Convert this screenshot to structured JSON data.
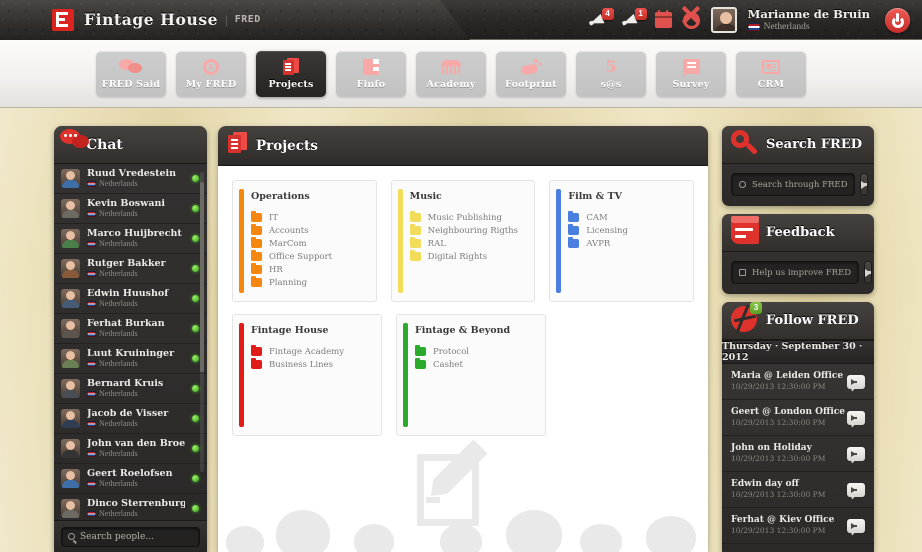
{
  "header": {
    "brand": "Fintage House",
    "brand_divider": "|",
    "brand_sub": "FRED",
    "notif1_badge": "4",
    "notif2_badge": "1",
    "user_name": "Marianne de Bruin",
    "user_country": "Netherlands"
  },
  "nav": {
    "tabs": [
      {
        "label": "FRED Said",
        "icon": "speech-icon",
        "active": false
      },
      {
        "label": "My FRED",
        "icon": "clock-icon",
        "active": false
      },
      {
        "label": "Projects",
        "icon": "documents-icon",
        "active": true
      },
      {
        "label": "Finfo",
        "icon": "f-letter-icon",
        "active": false
      },
      {
        "label": "Academy",
        "icon": "academy-icon",
        "active": false
      },
      {
        "label": "Footprint",
        "icon": "footprint-icon",
        "active": false
      },
      {
        "label": "s@s",
        "icon": "five-icon",
        "active": false
      },
      {
        "label": "Survey",
        "icon": "survey-icon",
        "active": false
      },
      {
        "label": "CRM",
        "icon": "crm-icon",
        "active": false
      }
    ]
  },
  "chat": {
    "title": "Chat",
    "search_placeholder": "Search people...",
    "people": [
      {
        "name": "Ruud Vredestein",
        "country": "Netherlands",
        "status": "online"
      },
      {
        "name": "Kevin Boswani",
        "country": "Netherlands",
        "status": "online"
      },
      {
        "name": "Marco Huijbrecht",
        "country": "Netherlands",
        "status": "online"
      },
      {
        "name": "Rutger Bakker",
        "country": "Netherlands",
        "status": "online"
      },
      {
        "name": "Edwin Huushof",
        "country": "Netherlands",
        "status": "online"
      },
      {
        "name": "Ferhat Burkan",
        "country": "Netherlands",
        "status": "online"
      },
      {
        "name": "Luut Kruininger",
        "country": "Netherlands",
        "status": "online"
      },
      {
        "name": "Bernard Kruis",
        "country": "Netherlands",
        "status": "online"
      },
      {
        "name": "Jacob de Visser",
        "country": "Netherlands",
        "status": "online"
      },
      {
        "name": "John van den Broek",
        "country": "Netherlands",
        "status": "online"
      },
      {
        "name": "Geert Roelofsen",
        "country": "Netherlands",
        "status": "online"
      },
      {
        "name": "Dinco Sterrenburg",
        "country": "Netherlands",
        "status": "online"
      }
    ]
  },
  "projects": {
    "title": "Projects",
    "cards": [
      {
        "title": "Operations",
        "color": "#f5870f",
        "items": [
          "IT",
          "Accounts",
          "MarCom",
          "Office Support",
          "HR",
          "Planning"
        ]
      },
      {
        "title": "Music",
        "color": "#f2dd5a",
        "items": [
          "Music Publishing",
          "Neighbouring Rigths",
          "RAL",
          "Digital Rights"
        ]
      },
      {
        "title": "Film & TV",
        "color": "#4a7fe0",
        "items": [
          "CAM",
          "Licensing",
          "AVPR"
        ]
      },
      {
        "title": "Fintage House",
        "color": "#e01b18",
        "items": [
          "Fintage Academy",
          "Business Lines"
        ]
      },
      {
        "title": "Fintage & Beyond",
        "color": "#2bab2b",
        "items": [
          "Protocol",
          "Cashet"
        ]
      }
    ]
  },
  "search_panel": {
    "title": "Search FRED",
    "placeholder": "Search through FRED"
  },
  "feedback_panel": {
    "title": "Feedback",
    "placeholder": "Help us improve FRED"
  },
  "follow_panel": {
    "title": "Follow FRED",
    "badge": "3",
    "date": "Thursday · September 30 · 2012",
    "items": [
      {
        "title": "Maria @ Leiden Office",
        "time": "10/29/2013 12:30:00 PM"
      },
      {
        "title": "Geert @ London Office",
        "time": "10/29/2013 12:30:00 PM"
      },
      {
        "title": "John on Holiday",
        "time": "10/29/2013 12:30:00 PM"
      },
      {
        "title": "Edwin day off",
        "time": "10/29/2013 12:30:00 PM"
      },
      {
        "title": "Ferhat @ Kiev Office",
        "time": "10/29/2013 12:30:00 PM"
      }
    ]
  }
}
